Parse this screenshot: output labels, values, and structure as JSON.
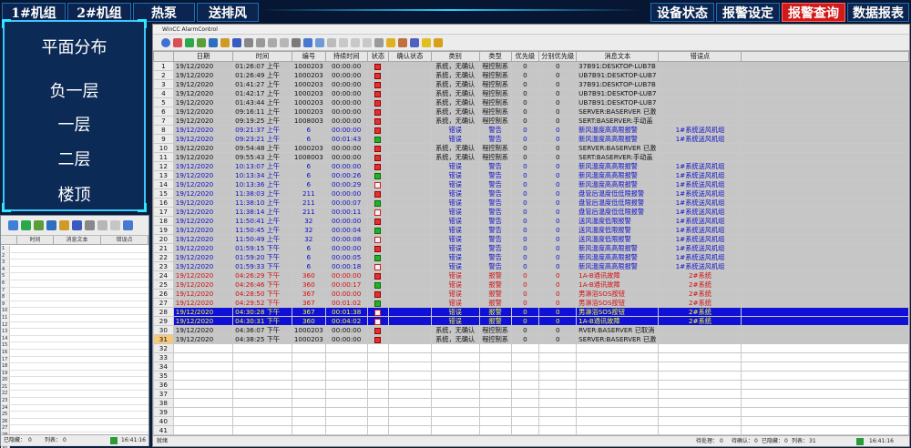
{
  "topnav": {
    "left": [
      "1#机组",
      "2#机组",
      "热泵",
      "送排风"
    ],
    "right": [
      "设备状态",
      "报警设定",
      "报警查询",
      "数据报表"
    ]
  },
  "leftnav": {
    "title": "平面分布",
    "items": [
      "负一层",
      "一层",
      "二层",
      "楼顶"
    ]
  },
  "leftpanel": {
    "columns": [
      "时间",
      "消息文本",
      "错误点"
    ],
    "row_numbers": [
      "1",
      "2",
      "3",
      "4",
      "5",
      "6",
      "7",
      "8",
      "9",
      "10",
      "11",
      "12",
      "13",
      "14",
      "15",
      "16",
      "17",
      "18",
      "19",
      "20",
      "21",
      "22",
      "23",
      "24",
      "25",
      "26",
      "27",
      "28",
      "29",
      "30"
    ],
    "status": {
      "label1": "已隐藏：",
      "val1": "0",
      "label2": "列表：",
      "val2": "0",
      "time": "16:41:16"
    }
  },
  "window": {
    "title": "WinCC AlarmControl"
  },
  "columns": [
    "",
    "日期",
    "时间",
    "编号",
    "持续时间",
    "状态",
    "确认状态",
    "类别",
    "类型",
    "优先级",
    "分别优先级",
    "消息文本",
    "错误点"
  ],
  "rows": [
    {
      "n": "1",
      "date": "19/12/2020",
      "time": "01:26:07 上午",
      "id": "1000203",
      "dur": "00:00:00",
      "st": "red",
      "ack": "",
      "cat": "系统，无确认",
      "type": "程控制系",
      "pri": "0",
      "pri2": "0",
      "msg": "37B91:DESKTOP-LUB7B",
      "err": "",
      "style": "gray"
    },
    {
      "n": "2",
      "date": "19/12/2020",
      "time": "01:26:49 上午",
      "id": "1000203",
      "dur": "00:00:00",
      "st": "red",
      "ack": "",
      "cat": "系统，无确认",
      "type": "程控制系",
      "pri": "0",
      "pri2": "0",
      "msg": "UB7B91:DESKTOP-LUB7",
      "err": "",
      "style": "gray"
    },
    {
      "n": "3",
      "date": "19/12/2020",
      "time": "01:41:27 上午",
      "id": "1000203",
      "dur": "00:00:00",
      "st": "red",
      "ack": "",
      "cat": "系统，无确认",
      "type": "程控制系",
      "pri": "0",
      "pri2": "0",
      "msg": "37B91:DESKTOP-LUB7B",
      "err": "",
      "style": "gray"
    },
    {
      "n": "4",
      "date": "19/12/2020",
      "time": "01:42:17 上午",
      "id": "1000203",
      "dur": "00:00:00",
      "st": "red",
      "ack": "",
      "cat": "系统，无确认",
      "type": "程控制系",
      "pri": "0",
      "pri2": "0",
      "msg": "UB7B91:DESKTOP-LUB7",
      "err": "",
      "style": "gray"
    },
    {
      "n": "5",
      "date": "19/12/2020",
      "time": "01:43:44 上午",
      "id": "1000203",
      "dur": "00:00:00",
      "st": "red",
      "ack": "",
      "cat": "系统，无确认",
      "type": "程控制系",
      "pri": "0",
      "pri2": "0",
      "msg": "UB7B91:DESKTOP-LUB7",
      "err": "",
      "style": "gray"
    },
    {
      "n": "6",
      "date": "19/12/2020",
      "time": "09:16:11 上午",
      "id": "1000203",
      "dur": "00:00:00",
      "st": "red",
      "ack": "",
      "cat": "系统，无确认",
      "type": "程控制系",
      "pri": "0",
      "pri2": "0",
      "msg": "SERVER:BASERVER 已激",
      "err": "",
      "style": "gray"
    },
    {
      "n": "7",
      "date": "19/12/2020",
      "time": "09:19:25 上午",
      "id": "1008003",
      "dur": "00:00:00",
      "st": "red",
      "ack": "",
      "cat": "系统，无确认",
      "type": "程控制系",
      "pri": "0",
      "pri2": "0",
      "msg": "SERT:BASERVER:手动盖",
      "err": "",
      "style": "gray"
    },
    {
      "n": "8",
      "date": "19/12/2020",
      "time": "09:21:37 上午",
      "id": "6",
      "dur": "00:00:00",
      "st": "red",
      "ack": "",
      "cat": "错误",
      "type": "警告",
      "pri": "0",
      "pri2": "0",
      "msg": "新风温度高高限报警",
      "err": "1#系统送风机组",
      "style": "blue"
    },
    {
      "n": "9",
      "date": "19/12/2020",
      "time": "09:23:21 上午",
      "id": "6",
      "dur": "00:01:43",
      "st": "green",
      "ack": "",
      "cat": "错误",
      "type": "警告",
      "pri": "0",
      "pri2": "0",
      "msg": "新风温度高高限报警",
      "err": "1#系统送风机组",
      "style": "blue"
    },
    {
      "n": "10",
      "date": "19/12/2020",
      "time": "09:54:48 上午",
      "id": "1000203",
      "dur": "00:00:00",
      "st": "red",
      "ack": "",
      "cat": "系统，无确认",
      "type": "程控制系",
      "pri": "0",
      "pri2": "0",
      "msg": "SERVER:BASERVER 已激",
      "err": "",
      "style": "gray"
    },
    {
      "n": "11",
      "date": "19/12/2020",
      "time": "09:55:43 上午",
      "id": "1008003",
      "dur": "00:00:00",
      "st": "red",
      "ack": "",
      "cat": "系统，无确认",
      "type": "程控制系",
      "pri": "0",
      "pri2": "0",
      "msg": "SERT:BASERVER:手动盖",
      "err": "",
      "style": "gray"
    },
    {
      "n": "12",
      "date": "19/12/2020",
      "time": "10:13:07 上午",
      "id": "6",
      "dur": "00:00:00",
      "st": "red",
      "ack": "",
      "cat": "错误",
      "type": "警告",
      "pri": "0",
      "pri2": "0",
      "msg": "新风温度高高限报警",
      "err": "1#系统送风机组",
      "style": "blue"
    },
    {
      "n": "13",
      "date": "19/12/2020",
      "time": "10:13:34 上午",
      "id": "6",
      "dur": "00:00:26",
      "st": "green",
      "ack": "",
      "cat": "错误",
      "type": "警告",
      "pri": "0",
      "pri2": "0",
      "msg": "新风温度高高限报警",
      "err": "1#系统送风机组",
      "style": "blue"
    },
    {
      "n": "14",
      "date": "19/12/2020",
      "time": "10:13:36 上午",
      "id": "6",
      "dur": "00:00:29",
      "st": "chk",
      "ack": "",
      "cat": "错误",
      "type": "警告",
      "pri": "0",
      "pri2": "0",
      "msg": "新风温度高高限报警",
      "err": "1#系统送风机组",
      "style": "blue"
    },
    {
      "n": "15",
      "date": "19/12/2020",
      "time": "11:38:03 上午",
      "id": "211",
      "dur": "00:00:00",
      "st": "red",
      "ack": "",
      "cat": "错误",
      "type": "警告",
      "pri": "0",
      "pri2": "0",
      "msg": "盘管后温度低低限报警",
      "err": "1#系统送风机组",
      "style": "blue"
    },
    {
      "n": "16",
      "date": "19/12/2020",
      "time": "11:38:10 上午",
      "id": "211",
      "dur": "00:00:07",
      "st": "green",
      "ack": "",
      "cat": "错误",
      "type": "警告",
      "pri": "0",
      "pri2": "0",
      "msg": "盘管后温度低低限报警",
      "err": "1#系统送风机组",
      "style": "blue"
    },
    {
      "n": "17",
      "date": "19/12/2020",
      "time": "11:38:14 上午",
      "id": "211",
      "dur": "00:00:11",
      "st": "chk",
      "ack": "",
      "cat": "错误",
      "type": "警告",
      "pri": "0",
      "pri2": "0",
      "msg": "盘管后温度低低限报警",
      "err": "1#系统送风机组",
      "style": "blue"
    },
    {
      "n": "18",
      "date": "19/12/2020",
      "time": "11:50:41 上午",
      "id": "32",
      "dur": "00:00:00",
      "st": "red",
      "ack": "",
      "cat": "错误",
      "type": "警告",
      "pri": "0",
      "pri2": "0",
      "msg": "送风温度低限报警",
      "err": "1#系统送风机组",
      "style": "blue"
    },
    {
      "n": "19",
      "date": "19/12/2020",
      "time": "11:50:45 上午",
      "id": "32",
      "dur": "00:00:04",
      "st": "green",
      "ack": "",
      "cat": "错误",
      "type": "警告",
      "pri": "0",
      "pri2": "0",
      "msg": "送风温度低限报警",
      "err": "1#系统送风机组",
      "style": "blue"
    },
    {
      "n": "20",
      "date": "19/12/2020",
      "time": "11:50:49 上午",
      "id": "32",
      "dur": "00:00:08",
      "st": "chk",
      "ack": "",
      "cat": "错误",
      "type": "警告",
      "pri": "0",
      "pri2": "0",
      "msg": "送风温度低限报警",
      "err": "1#系统送风机组",
      "style": "blue"
    },
    {
      "n": "21",
      "date": "19/12/2020",
      "time": "01:59:15 下午",
      "id": "6",
      "dur": "00:00:00",
      "st": "red",
      "ack": "",
      "cat": "错误",
      "type": "警告",
      "pri": "0",
      "pri2": "0",
      "msg": "新风温度高高限报警",
      "err": "1#系统送风机组",
      "style": "blue"
    },
    {
      "n": "22",
      "date": "19/12/2020",
      "time": "01:59:20 下午",
      "id": "6",
      "dur": "00:00:05",
      "st": "green",
      "ack": "",
      "cat": "错误",
      "type": "警告",
      "pri": "0",
      "pri2": "0",
      "msg": "新风温度高高限报警",
      "err": "1#系统送风机组",
      "style": "blue"
    },
    {
      "n": "23",
      "date": "19/12/2020",
      "time": "01:59:33 下午",
      "id": "6",
      "dur": "00:00:18",
      "st": "chk",
      "ack": "",
      "cat": "错误",
      "type": "警告",
      "pri": "0",
      "pri2": "0",
      "msg": "新风温度高高限报警",
      "err": "1#系统送风机组",
      "style": "blue"
    },
    {
      "n": "24",
      "date": "19/12/2020",
      "time": "04:26:29 下午",
      "id": "360",
      "dur": "00:00:00",
      "st": "red",
      "ack": "",
      "cat": "错误",
      "type": "报警",
      "pri": "0",
      "pri2": "0",
      "msg": "1A-B通讯故障",
      "err": "2#系统",
      "style": "red"
    },
    {
      "n": "25",
      "date": "19/12/2020",
      "time": "04:26:46 下午",
      "id": "360",
      "dur": "00:00:17",
      "st": "green",
      "ack": "",
      "cat": "错误",
      "type": "报警",
      "pri": "0",
      "pri2": "0",
      "msg": "1A-B通讯故障",
      "err": "2#系统",
      "style": "red"
    },
    {
      "n": "26",
      "date": "19/12/2020",
      "time": "04:28:50 下午",
      "id": "367",
      "dur": "00:00:00",
      "st": "red",
      "ack": "",
      "cat": "错误",
      "type": "报警",
      "pri": "0",
      "pri2": "0",
      "msg": "男淋浴SOS按钮",
      "err": "2#系统",
      "style": "red"
    },
    {
      "n": "27",
      "date": "19/12/2020",
      "time": "04:29:52 下午",
      "id": "367",
      "dur": "00:01:02",
      "st": "green",
      "ack": "",
      "cat": "错误",
      "type": "报警",
      "pri": "0",
      "pri2": "0",
      "msg": "男淋浴SOS按钮",
      "err": "2#系统",
      "style": "red"
    },
    {
      "n": "28",
      "date": "19/12/2020",
      "time": "04:30:28 下午",
      "id": "367",
      "dur": "00:01:38",
      "st": "chk",
      "ack": "",
      "cat": "错误",
      "type": "报警",
      "pri": "0",
      "pri2": "0",
      "msg": "男淋浴SOS按钮",
      "err": "2#系统",
      "style": "hl"
    },
    {
      "n": "29",
      "date": "19/12/2020",
      "time": "04:30:31 下午",
      "id": "360",
      "dur": "00:04:02",
      "st": "chk",
      "ack": "",
      "cat": "错误",
      "type": "报警",
      "pri": "0",
      "pri2": "0",
      "msg": "1A-B通讯故障",
      "err": "2#系统",
      "style": "hl"
    },
    {
      "n": "30",
      "date": "19/12/2020",
      "time": "04:36:07 下午",
      "id": "1000203",
      "dur": "00:00:00",
      "st": "red",
      "ack": "",
      "cat": "系统，无确认",
      "type": "程控制系",
      "pri": "0",
      "pri2": "0",
      "msg": "RVER:BASERVER 已取消",
      "err": "",
      "style": "gray"
    },
    {
      "n": "31",
      "date": "19/12/2020",
      "time": "04:38:25 下午",
      "id": "1000203",
      "dur": "00:00:00",
      "st": "red",
      "ack": "",
      "cat": "系统，无确认",
      "type": "程控制系",
      "pri": "0",
      "pri2": "0",
      "msg": "SERVER:BASERVER 已激",
      "err": "",
      "style": "gray",
      "sel": true
    }
  ],
  "empty_rows": [
    "32",
    "33",
    "34",
    "35",
    "36",
    "37",
    "38",
    "39",
    "40",
    "41",
    "42"
  ],
  "statusbar": {
    "left": "就绪",
    "pending_label": "待处理：",
    "pending": "0",
    "ack_label": "待确认：",
    "ack": "0",
    "hidden_label": "已隐藏：",
    "hidden": "0",
    "list_label": "列表：",
    "list": "31",
    "time": "16:41:16"
  }
}
